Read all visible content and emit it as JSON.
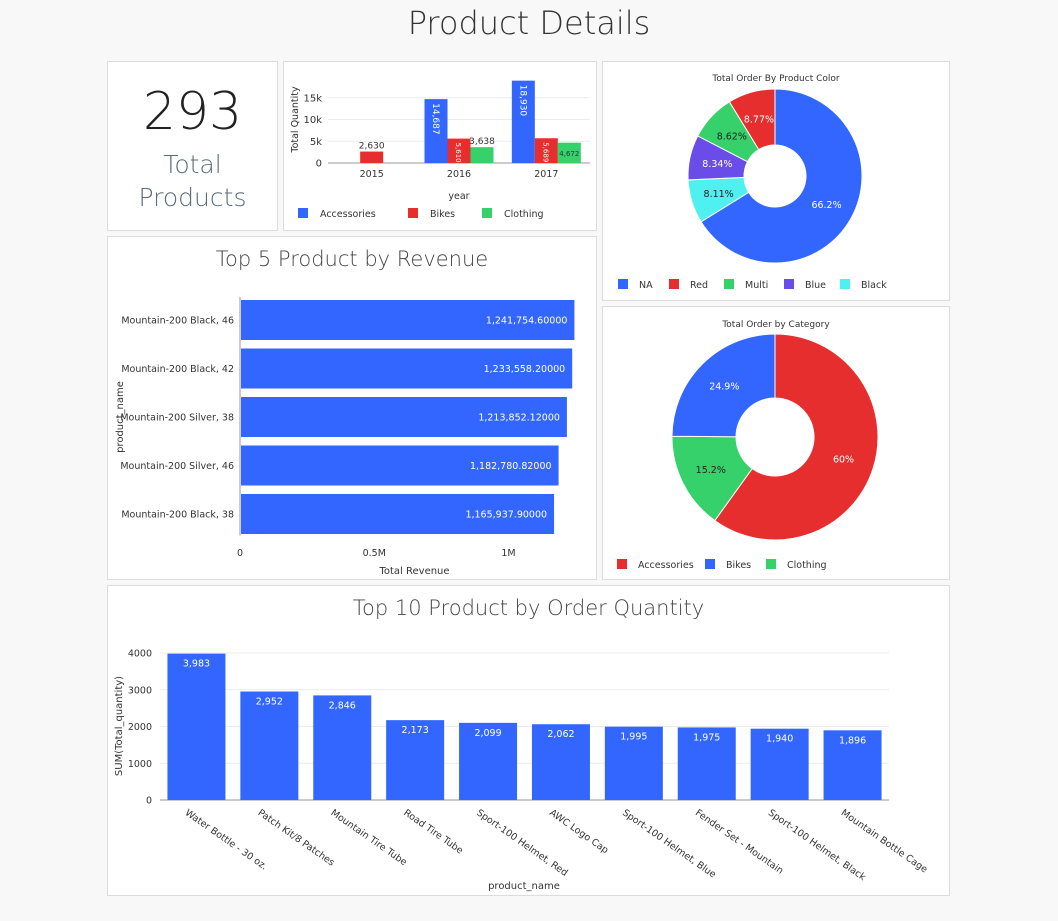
{
  "page": {
    "title": "Product Details"
  },
  "kpi": {
    "value": "293",
    "label_line1": "Total",
    "label_line2": "Products"
  },
  "chart_data": [
    {
      "id": "yearly",
      "type": "bar",
      "title": "",
      "xlabel": "year",
      "ylabel": "Total Quantity",
      "categories": [
        "2015",
        "2016",
        "2017"
      ],
      "ylim": [
        0,
        20000
      ],
      "yticks": [
        0,
        5000,
        10000,
        15000
      ],
      "ytick_labels": [
        "0",
        "5k",
        "10k",
        "15k"
      ],
      "series": [
        {
          "name": "Accessories",
          "color": "#3366ff",
          "values": [
            null,
            14687,
            18930
          ],
          "labels": [
            "",
            "14,687",
            "18,930"
          ]
        },
        {
          "name": "Bikes",
          "color": "#e62e2e",
          "values": [
            2630,
            5610,
            5689
          ],
          "labels": [
            "2,630",
            "5,610",
            "5,689"
          ]
        },
        {
          "name": "Clothing",
          "color": "#36d16b",
          "values": [
            null,
            3638,
            4672
          ],
          "labels": [
            "",
            "3,638",
            "4,672"
          ]
        }
      ],
      "legend": "bottom-left"
    },
    {
      "id": "color-donut",
      "type": "pie",
      "title": "Total Order By Product Color",
      "slices": [
        {
          "name": "NA",
          "value": 66.2,
          "label": "66.2%",
          "color": "#3366ff"
        },
        {
          "name": "Black",
          "value": 8.11,
          "label": "8.11%",
          "color": "#4ff0f0"
        },
        {
          "name": "Blue",
          "value": 8.34,
          "label": "8.34%",
          "color": "#6a4ce8"
        },
        {
          "name": "Multi",
          "value": 8.62,
          "label": "8.62%",
          "color": "#36d16b"
        },
        {
          "name": "Red",
          "value": 8.77,
          "label": "8.77%",
          "color": "#e62e2e"
        }
      ],
      "legend_order": [
        "NA",
        "Red",
        "Multi",
        "Blue",
        "Black"
      ],
      "legend": "bottom"
    },
    {
      "id": "revenue",
      "type": "bar",
      "orientation": "horizontal",
      "title": "Top 5 Product by Revenue",
      "xlabel": "Total Revenue",
      "ylabel": "product_name",
      "categories": [
        "Mountain-200 Black, 46",
        "Mountain-200 Black, 42",
        "Mountain-200 Silver, 38",
        "Mountain-200 Silver, 46",
        "Mountain-200 Black, 38"
      ],
      "values": [
        1241754.6,
        1233558.2,
        1213852.12,
        1182780.82,
        1165937.9
      ],
      "labels": [
        "1,241,754.60000",
        "1,233,558.20000",
        "1,213,852.12000",
        "1,182,780.82000",
        "1,165,937.90000"
      ],
      "xlim": [
        0,
        1300000
      ],
      "xticks": [
        0,
        500000,
        1000000
      ],
      "xtick_labels": [
        "0",
        "0.5M",
        "1M"
      ],
      "color": "#3366ff"
    },
    {
      "id": "category-donut",
      "type": "pie",
      "title": "Total Order by Category",
      "slices": [
        {
          "name": "Accessories",
          "value": 60,
          "label": "60%",
          "color": "#e62e2e"
        },
        {
          "name": "Clothing",
          "value": 15.2,
          "label": "15.2%",
          "color": "#36d16b"
        },
        {
          "name": "Bikes",
          "value": 24.9,
          "label": "24.9%",
          "color": "#3366ff"
        }
      ],
      "legend_order": [
        "Accessories",
        "Bikes",
        "Clothing"
      ],
      "legend": "bottom"
    },
    {
      "id": "quantity",
      "type": "bar",
      "title": "Top 10 Product by Order Quantity",
      "xlabel": "product_name",
      "ylabel": "SUM(Total_quantity)",
      "categories": [
        "Water Bottle - 30 oz.",
        "Patch Kit/8 Patches",
        "Mountain Tire Tube",
        "Road Tire Tube",
        "Sport-100 Helmet, Red",
        "AWC Logo Cap",
        "Sport-100 Helmet, Blue",
        "Fender Set - Mountain",
        "Sport-100 Helmet, Black",
        "Mountain Bottle Cage"
      ],
      "values": [
        3983,
        2952,
        2846,
        2173,
        2099,
        2062,
        1995,
        1975,
        1940,
        1896
      ],
      "labels": [
        "3,983",
        "2,952",
        "2,846",
        "2,173",
        "2,099",
        "2,062",
        "1,995",
        "1,975",
        "1,940",
        "1,896"
      ],
      "ylim": [
        0,
        4000
      ],
      "yticks": [
        0,
        1000,
        2000,
        3000,
        4000
      ],
      "ytick_labels": [
        "0",
        "1000",
        "2000",
        "3000",
        "4000"
      ],
      "color": "#3366ff"
    }
  ]
}
